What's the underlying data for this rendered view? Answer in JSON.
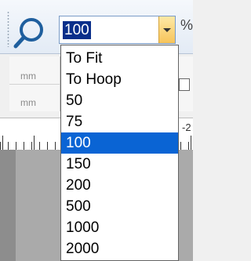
{
  "zoom": {
    "current_value": "100",
    "unit_symbol": "%",
    "selected_option": "100",
    "options": [
      "To Fit",
      "To Hoop",
      "50",
      "75",
      "100",
      "150",
      "200",
      "500",
      "1000",
      "2000"
    ]
  },
  "measure_panel": {
    "unit_top": "mm",
    "unit_bottom": "mm"
  },
  "ruler": {
    "edge_label": "-2"
  },
  "icons": {
    "zoom": "magnifier-icon",
    "dropdown": "chevron-down-icon"
  },
  "colors": {
    "selection": "#0a64d4",
    "value_highlight": "#0a2f8a",
    "dropdown_button": "#f7c45a"
  }
}
